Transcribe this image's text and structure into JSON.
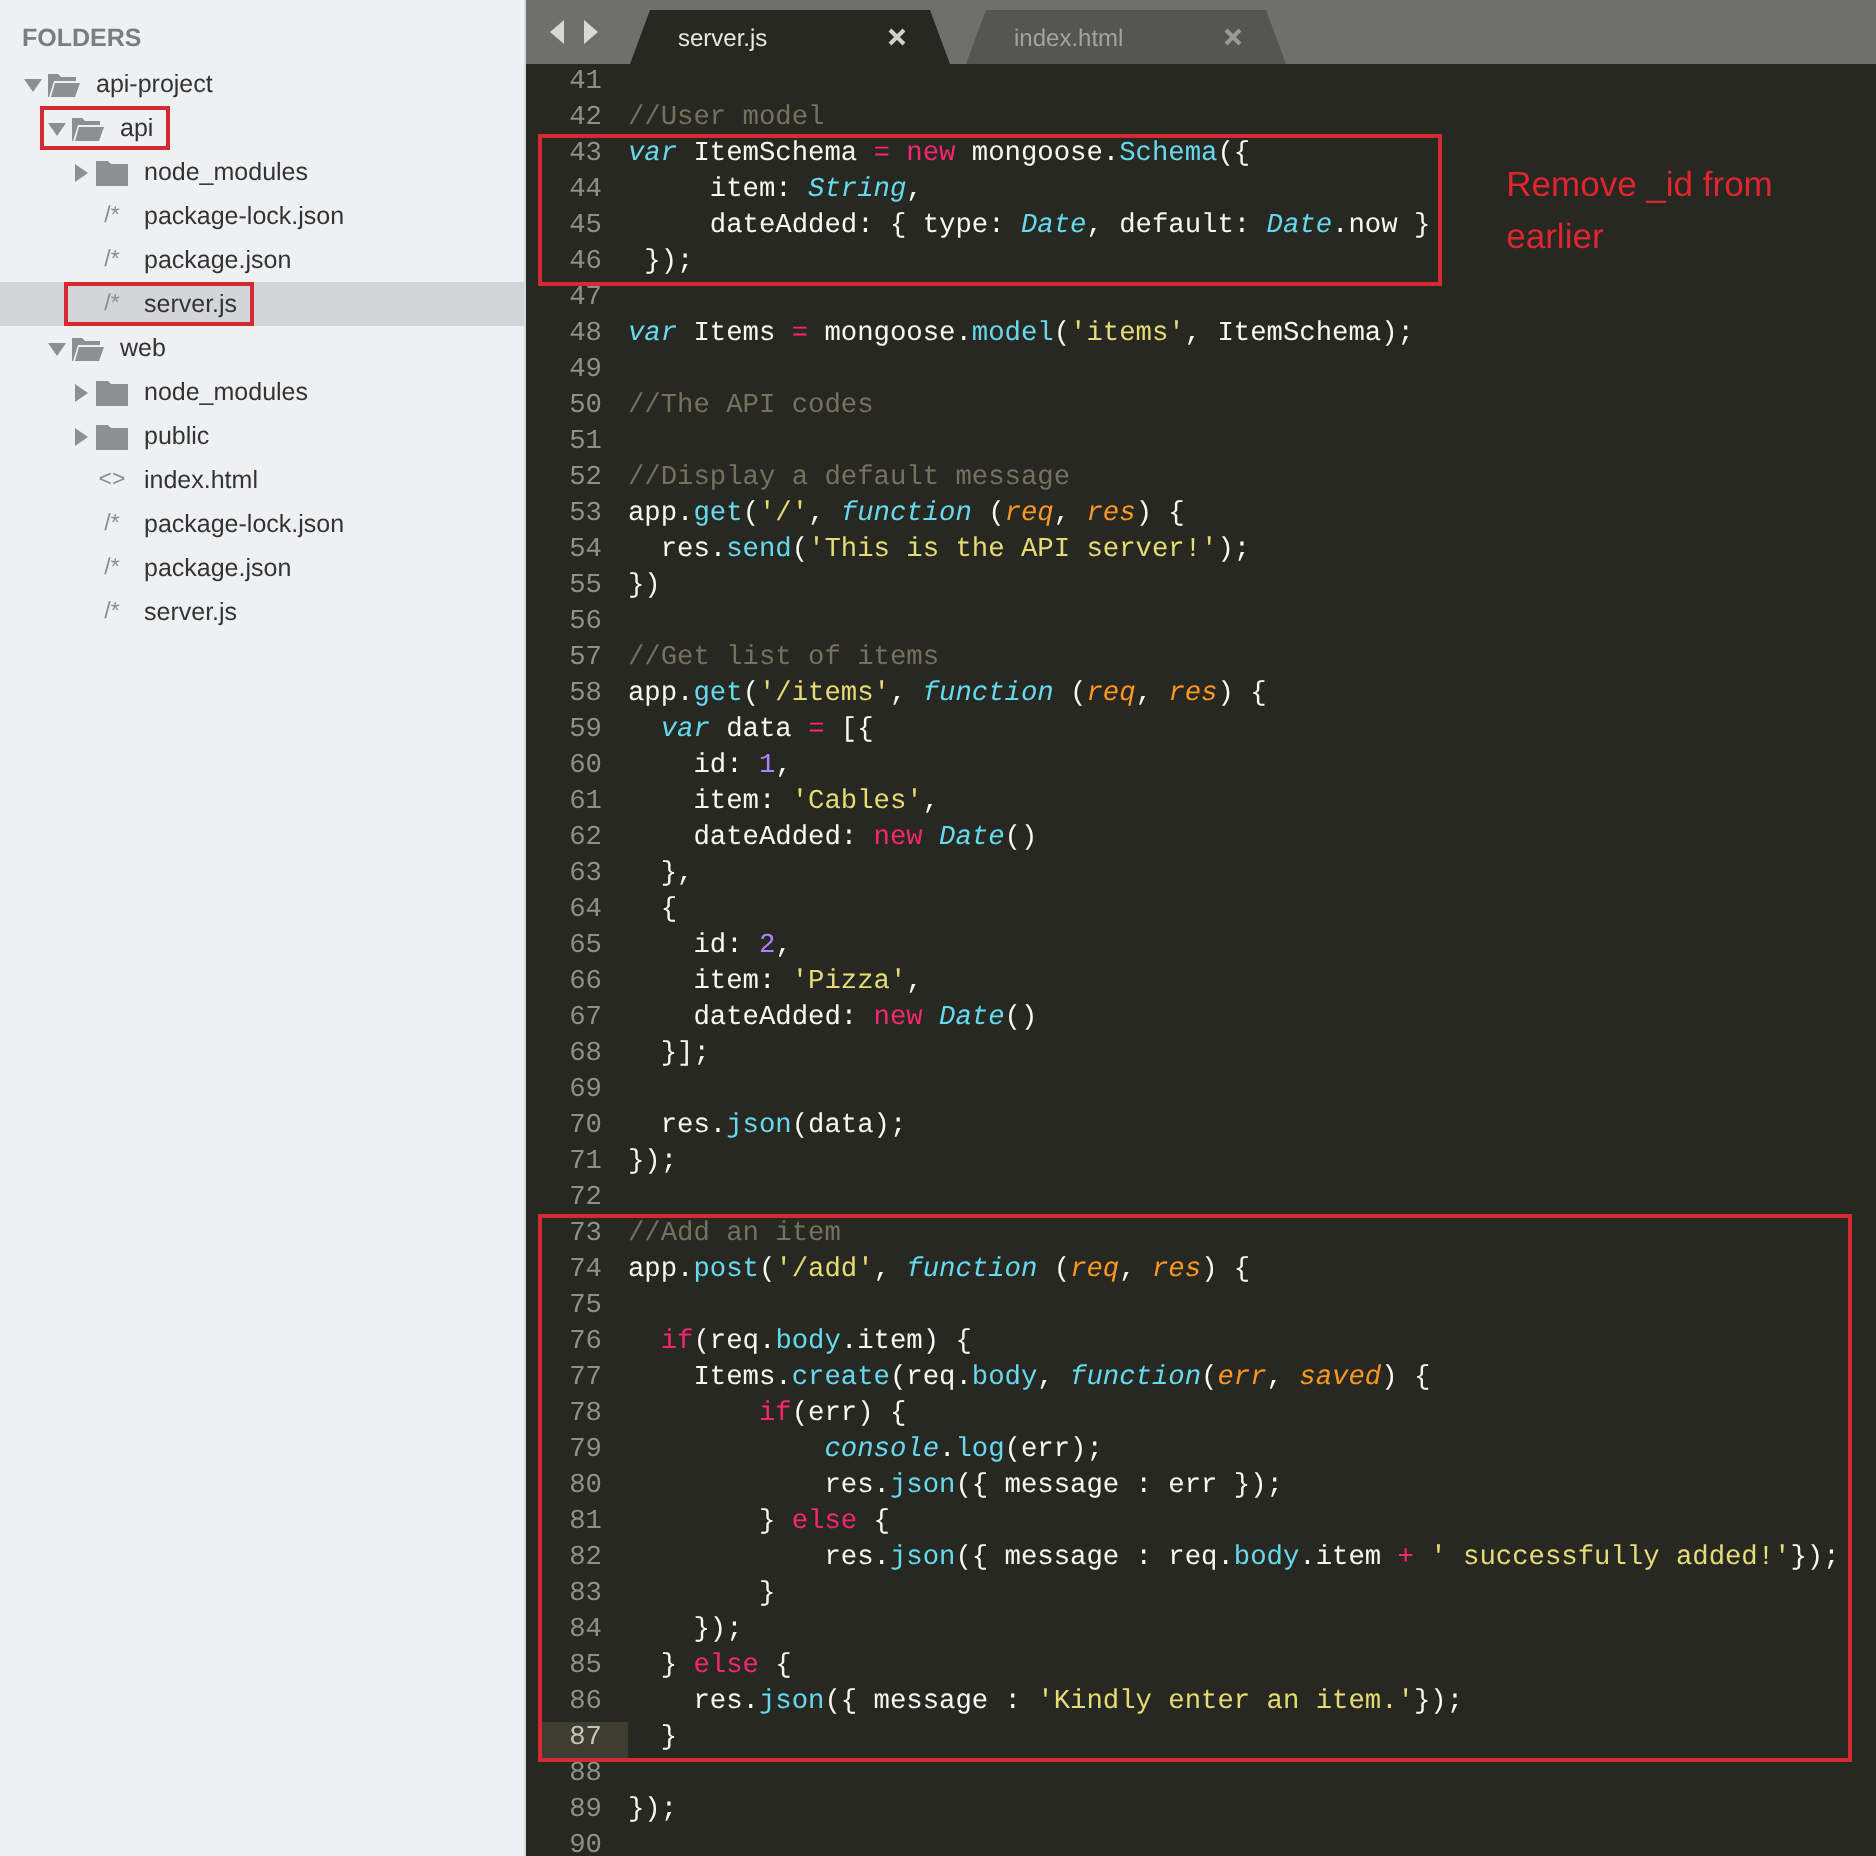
{
  "sidebar": {
    "title": "FOLDERS",
    "tree": [
      {
        "label": "api-project",
        "kind": "folder",
        "expanded": true,
        "selected": false,
        "highlighted": false,
        "children": [
          {
            "label": "api",
            "kind": "folder",
            "expanded": true,
            "selected": false,
            "highlighted": true,
            "children": [
              {
                "label": "node_modules",
                "kind": "folder",
                "expanded": false,
                "selected": false,
                "highlighted": false
              },
              {
                "label": "package-lock.json",
                "kind": "file",
                "icon": "/*",
                "selected": false,
                "highlighted": false
              },
              {
                "label": "package.json",
                "kind": "file",
                "icon": "/*",
                "selected": false,
                "highlighted": false
              },
              {
                "label": "server.js",
                "kind": "file",
                "icon": "/*",
                "selected": true,
                "highlighted": true
              }
            ]
          },
          {
            "label": "web",
            "kind": "folder",
            "expanded": true,
            "selected": false,
            "highlighted": false,
            "children": [
              {
                "label": "node_modules",
                "kind": "folder",
                "expanded": false,
                "selected": false,
                "highlighted": false
              },
              {
                "label": "public",
                "kind": "folder",
                "expanded": false,
                "selected": false,
                "highlighted": false
              },
              {
                "label": "index.html",
                "kind": "file",
                "icon": "<>",
                "selected": false,
                "highlighted": false
              },
              {
                "label": "package-lock.json",
                "kind": "file",
                "icon": "/*",
                "selected": false,
                "highlighted": false
              },
              {
                "label": "package.json",
                "kind": "file",
                "icon": "/*",
                "selected": false,
                "highlighted": false
              },
              {
                "label": "server.js",
                "kind": "file",
                "icon": "/*",
                "selected": false,
                "highlighted": false
              }
            ]
          }
        ]
      }
    ]
  },
  "tabs": [
    {
      "label": "server.js",
      "selected": true
    },
    {
      "label": "index.html",
      "selected": false
    }
  ],
  "editor": {
    "blocks": [
      {
        "boxed": false,
        "lines": [
          {
            "number": "41",
            "current": false
          },
          {
            "number": "42",
            "current": false,
            "tokens": [
              {
                "text": "//User model",
                "kind": "comment"
              }
            ]
          }
        ]
      },
      {
        "boxed": true,
        "note": "Remove _id from earlier",
        "lines": [
          {
            "number": "43",
            "current": false,
            "tokens": [
              {
                "text": "var",
                "kind": "storage"
              },
              {
                "text": " ItemSchema ",
                "kind": "plain"
              },
              {
                "text": "= ",
                "kind": "keyword"
              },
              {
                "text": "new",
                "kind": "keyword"
              },
              {
                "text": " mongoose.",
                "kind": "plain"
              },
              {
                "text": "Schema",
                "kind": "support"
              },
              {
                "text": "({",
                "kind": "plain"
              }
            ]
          },
          {
            "number": "44",
            "current": false,
            "tokens": [
              {
                "text": "     item: ",
                "kind": "plain"
              },
              {
                "text": "String",
                "kind": "type"
              },
              {
                "text": ",",
                "kind": "plain"
              }
            ]
          },
          {
            "number": "45",
            "current": false,
            "tokens": [
              {
                "text": "     dateAdded: { type: ",
                "kind": "plain"
              },
              {
                "text": "Date",
                "kind": "type"
              },
              {
                "text": ", default: ",
                "kind": "plain"
              },
              {
                "text": "Date",
                "kind": "type"
              },
              {
                "text": ".now }",
                "kind": "plain"
              }
            ]
          },
          {
            "number": "46",
            "current": false,
            "tokens": [
              {
                "text": " });",
                "kind": "plain"
              }
            ]
          }
        ]
      },
      {
        "boxed": false,
        "lines": [
          {
            "number": "47",
            "current": false
          },
          {
            "number": "48",
            "current": false,
            "tokens": [
              {
                "text": "var",
                "kind": "storage"
              },
              {
                "text": " Items ",
                "kind": "plain"
              },
              {
                "text": "=",
                "kind": "keyword"
              },
              {
                "text": " mongoose.",
                "kind": "plain"
              },
              {
                "text": "model",
                "kind": "support"
              },
              {
                "text": "(",
                "kind": "plain"
              },
              {
                "text": "'items'",
                "kind": "string"
              },
              {
                "text": ", ItemSchema);",
                "kind": "plain"
              }
            ]
          },
          {
            "number": "49",
            "current": false
          },
          {
            "number": "50",
            "current": false,
            "tokens": [
              {
                "text": "//The API codes",
                "kind": "comment"
              }
            ]
          },
          {
            "number": "51",
            "current": false
          },
          {
            "number": "52",
            "current": false,
            "tokens": [
              {
                "text": "//Display a default message",
                "kind": "comment"
              }
            ]
          },
          {
            "number": "53",
            "current": false,
            "tokens": [
              {
                "text": "app.",
                "kind": "plain"
              },
              {
                "text": "get",
                "kind": "support"
              },
              {
                "text": "(",
                "kind": "plain"
              },
              {
                "text": "'/'",
                "kind": "string"
              },
              {
                "text": ", ",
                "kind": "plain"
              },
              {
                "text": "function",
                "kind": "storage"
              },
              {
                "text": " (",
                "kind": "plain"
              },
              {
                "text": "req",
                "kind": "param"
              },
              {
                "text": ", ",
                "kind": "plain"
              },
              {
                "text": "res",
                "kind": "param"
              },
              {
                "text": ") {",
                "kind": "plain"
              }
            ]
          },
          {
            "number": "54",
            "current": false,
            "tokens": [
              {
                "text": "  res.",
                "kind": "plain"
              },
              {
                "text": "send",
                "kind": "support"
              },
              {
                "text": "(",
                "kind": "plain"
              },
              {
                "text": "'This is the API server!'",
                "kind": "string"
              },
              {
                "text": ");",
                "kind": "plain"
              }
            ]
          },
          {
            "number": "55",
            "current": false,
            "tokens": [
              {
                "text": "})",
                "kind": "plain"
              }
            ]
          },
          {
            "number": "56",
            "current": false
          },
          {
            "number": "57",
            "current": false,
            "tokens": [
              {
                "text": "//Get list of items",
                "kind": "comment"
              }
            ]
          },
          {
            "number": "58",
            "current": false,
            "tokens": [
              {
                "text": "app.",
                "kind": "plain"
              },
              {
                "text": "get",
                "kind": "support"
              },
              {
                "text": "(",
                "kind": "plain"
              },
              {
                "text": "'/items'",
                "kind": "string"
              },
              {
                "text": ", ",
                "kind": "plain"
              },
              {
                "text": "function",
                "kind": "storage"
              },
              {
                "text": " (",
                "kind": "plain"
              },
              {
                "text": "req",
                "kind": "param"
              },
              {
                "text": ", ",
                "kind": "plain"
              },
              {
                "text": "res",
                "kind": "param"
              },
              {
                "text": ") {",
                "kind": "plain"
              }
            ]
          },
          {
            "number": "59",
            "current": false,
            "tokens": [
              {
                "text": "  var",
                "kind": "storage"
              },
              {
                "text": " data ",
                "kind": "plain"
              },
              {
                "text": "=",
                "kind": "keyword"
              },
              {
                "text": " [{",
                "kind": "plain"
              }
            ]
          },
          {
            "number": "60",
            "current": false,
            "tokens": [
              {
                "text": "    id: ",
                "kind": "plain"
              },
              {
                "text": "1",
                "kind": "number"
              },
              {
                "text": ",",
                "kind": "plain"
              }
            ]
          },
          {
            "number": "61",
            "current": false,
            "tokens": [
              {
                "text": "    item: ",
                "kind": "plain"
              },
              {
                "text": "'Cables'",
                "kind": "string"
              },
              {
                "text": ",",
                "kind": "plain"
              }
            ]
          },
          {
            "number": "62",
            "current": false,
            "tokens": [
              {
                "text": "    dateAdded: ",
                "kind": "plain"
              },
              {
                "text": "new ",
                "kind": "keyword"
              },
              {
                "text": "Date",
                "kind": "type"
              },
              {
                "text": "()",
                "kind": "plain"
              }
            ]
          },
          {
            "number": "63",
            "current": false,
            "tokens": [
              {
                "text": "  },",
                "kind": "plain"
              }
            ]
          },
          {
            "number": "64",
            "current": false,
            "tokens": [
              {
                "text": "  {",
                "kind": "plain"
              }
            ]
          },
          {
            "number": "65",
            "current": false,
            "tokens": [
              {
                "text": "    id: ",
                "kind": "plain"
              },
              {
                "text": "2",
                "kind": "number"
              },
              {
                "text": ",",
                "kind": "plain"
              }
            ]
          },
          {
            "number": "66",
            "current": false,
            "tokens": [
              {
                "text": "    item: ",
                "kind": "plain"
              },
              {
                "text": "'Pizza'",
                "kind": "string"
              },
              {
                "text": ",",
                "kind": "plain"
              }
            ]
          },
          {
            "number": "67",
            "current": false,
            "tokens": [
              {
                "text": "    dateAdded: ",
                "kind": "plain"
              },
              {
                "text": "new ",
                "kind": "keyword"
              },
              {
                "text": "Date",
                "kind": "type"
              },
              {
                "text": "()",
                "kind": "plain"
              }
            ]
          },
          {
            "number": "68",
            "current": false,
            "tokens": [
              {
                "text": "  }];",
                "kind": "plain"
              }
            ]
          },
          {
            "number": "69",
            "current": false
          },
          {
            "number": "70",
            "current": false,
            "tokens": [
              {
                "text": "  res.",
                "kind": "plain"
              },
              {
                "text": "json",
                "kind": "support"
              },
              {
                "text": "(data);",
                "kind": "plain"
              }
            ]
          },
          {
            "number": "71",
            "current": false,
            "tokens": [
              {
                "text": "});",
                "kind": "plain"
              }
            ]
          },
          {
            "number": "72",
            "current": false
          }
        ]
      },
      {
        "boxed": true,
        "lines": [
          {
            "number": "73",
            "current": false,
            "tokens": [
              {
                "text": "//Add an item",
                "kind": "comment"
              }
            ]
          },
          {
            "number": "74",
            "current": false,
            "tokens": [
              {
                "text": "app.",
                "kind": "plain"
              },
              {
                "text": "post",
                "kind": "support"
              },
              {
                "text": "(",
                "kind": "plain"
              },
              {
                "text": "'/add'",
                "kind": "string"
              },
              {
                "text": ", ",
                "kind": "plain"
              },
              {
                "text": "function",
                "kind": "storage"
              },
              {
                "text": " (",
                "kind": "plain"
              },
              {
                "text": "req",
                "kind": "param"
              },
              {
                "text": ", ",
                "kind": "plain"
              },
              {
                "text": "res",
                "kind": "param"
              },
              {
                "text": ") {",
                "kind": "plain"
              }
            ]
          },
          {
            "number": "75",
            "current": false
          },
          {
            "number": "76",
            "current": false,
            "tokens": [
              {
                "text": "  if",
                "kind": "keyword"
              },
              {
                "text": "(req.",
                "kind": "plain"
              },
              {
                "text": "body",
                "kind": "support"
              },
              {
                "text": ".item) {",
                "kind": "plain"
              }
            ]
          },
          {
            "number": "77",
            "current": false,
            "tokens": [
              {
                "text": "    Items.",
                "kind": "plain"
              },
              {
                "text": "create",
                "kind": "support"
              },
              {
                "text": "(req.",
                "kind": "plain"
              },
              {
                "text": "body",
                "kind": "support"
              },
              {
                "text": ", ",
                "kind": "plain"
              },
              {
                "text": "function",
                "kind": "storage"
              },
              {
                "text": "(",
                "kind": "plain"
              },
              {
                "text": "err",
                "kind": "param"
              },
              {
                "text": ", ",
                "kind": "plain"
              },
              {
                "text": "saved",
                "kind": "param"
              },
              {
                "text": ") {",
                "kind": "plain"
              }
            ]
          },
          {
            "number": "78",
            "current": false,
            "tokens": [
              {
                "text": "        if",
                "kind": "keyword"
              },
              {
                "text": "(err) {",
                "kind": "plain"
              }
            ]
          },
          {
            "number": "79",
            "current": false,
            "tokens": [
              {
                "text": "            console",
                "kind": "type"
              },
              {
                "text": ".",
                "kind": "plain"
              },
              {
                "text": "log",
                "kind": "support"
              },
              {
                "text": "(err);",
                "kind": "plain"
              }
            ]
          },
          {
            "number": "80",
            "current": false,
            "tokens": [
              {
                "text": "            res.",
                "kind": "plain"
              },
              {
                "text": "json",
                "kind": "support"
              },
              {
                "text": "({ message : err });",
                "kind": "plain"
              }
            ]
          },
          {
            "number": "81",
            "current": false,
            "tokens": [
              {
                "text": "        } ",
                "kind": "plain"
              },
              {
                "text": "else",
                "kind": "keyword"
              },
              {
                "text": " {",
                "kind": "plain"
              }
            ]
          },
          {
            "number": "82",
            "current": false,
            "tokens": [
              {
                "text": "            res.",
                "kind": "plain"
              },
              {
                "text": "json",
                "kind": "support"
              },
              {
                "text": "({ message : req.",
                "kind": "plain"
              },
              {
                "text": "body",
                "kind": "support"
              },
              {
                "text": ".item ",
                "kind": "plain"
              },
              {
                "text": "+ ",
                "kind": "keyword"
              },
              {
                "text": "' successfully added!'",
                "kind": "string"
              },
              {
                "text": "});",
                "kind": "plain"
              }
            ]
          },
          {
            "number": "83",
            "current": false,
            "tokens": [
              {
                "text": "        }",
                "kind": "plain"
              }
            ]
          },
          {
            "number": "84",
            "current": false,
            "tokens": [
              {
                "text": "    });",
                "kind": "plain"
              }
            ]
          },
          {
            "number": "85",
            "current": false,
            "tokens": [
              {
                "text": "  } ",
                "kind": "plain"
              },
              {
                "text": "else",
                "kind": "keyword"
              },
              {
                "text": " {",
                "kind": "plain"
              }
            ]
          },
          {
            "number": "86",
            "current": false,
            "tokens": [
              {
                "text": "    res.",
                "kind": "plain"
              },
              {
                "text": "json",
                "kind": "support"
              },
              {
                "text": "({ message : ",
                "kind": "plain"
              },
              {
                "text": "'Kindly enter an item.'",
                "kind": "string"
              },
              {
                "text": "});",
                "kind": "plain"
              }
            ]
          },
          {
            "number": "87",
            "current": true,
            "tokens": [
              {
                "text": "  }",
                "kind": "plain"
              }
            ]
          }
        ]
      },
      {
        "boxed": false,
        "lines": [
          {
            "number": "88",
            "current": false
          },
          {
            "number": "89",
            "current": false,
            "tokens": [
              {
                "text": "});",
                "kind": "plain"
              }
            ]
          },
          {
            "number": "90",
            "current": false
          }
        ]
      }
    ]
  }
}
